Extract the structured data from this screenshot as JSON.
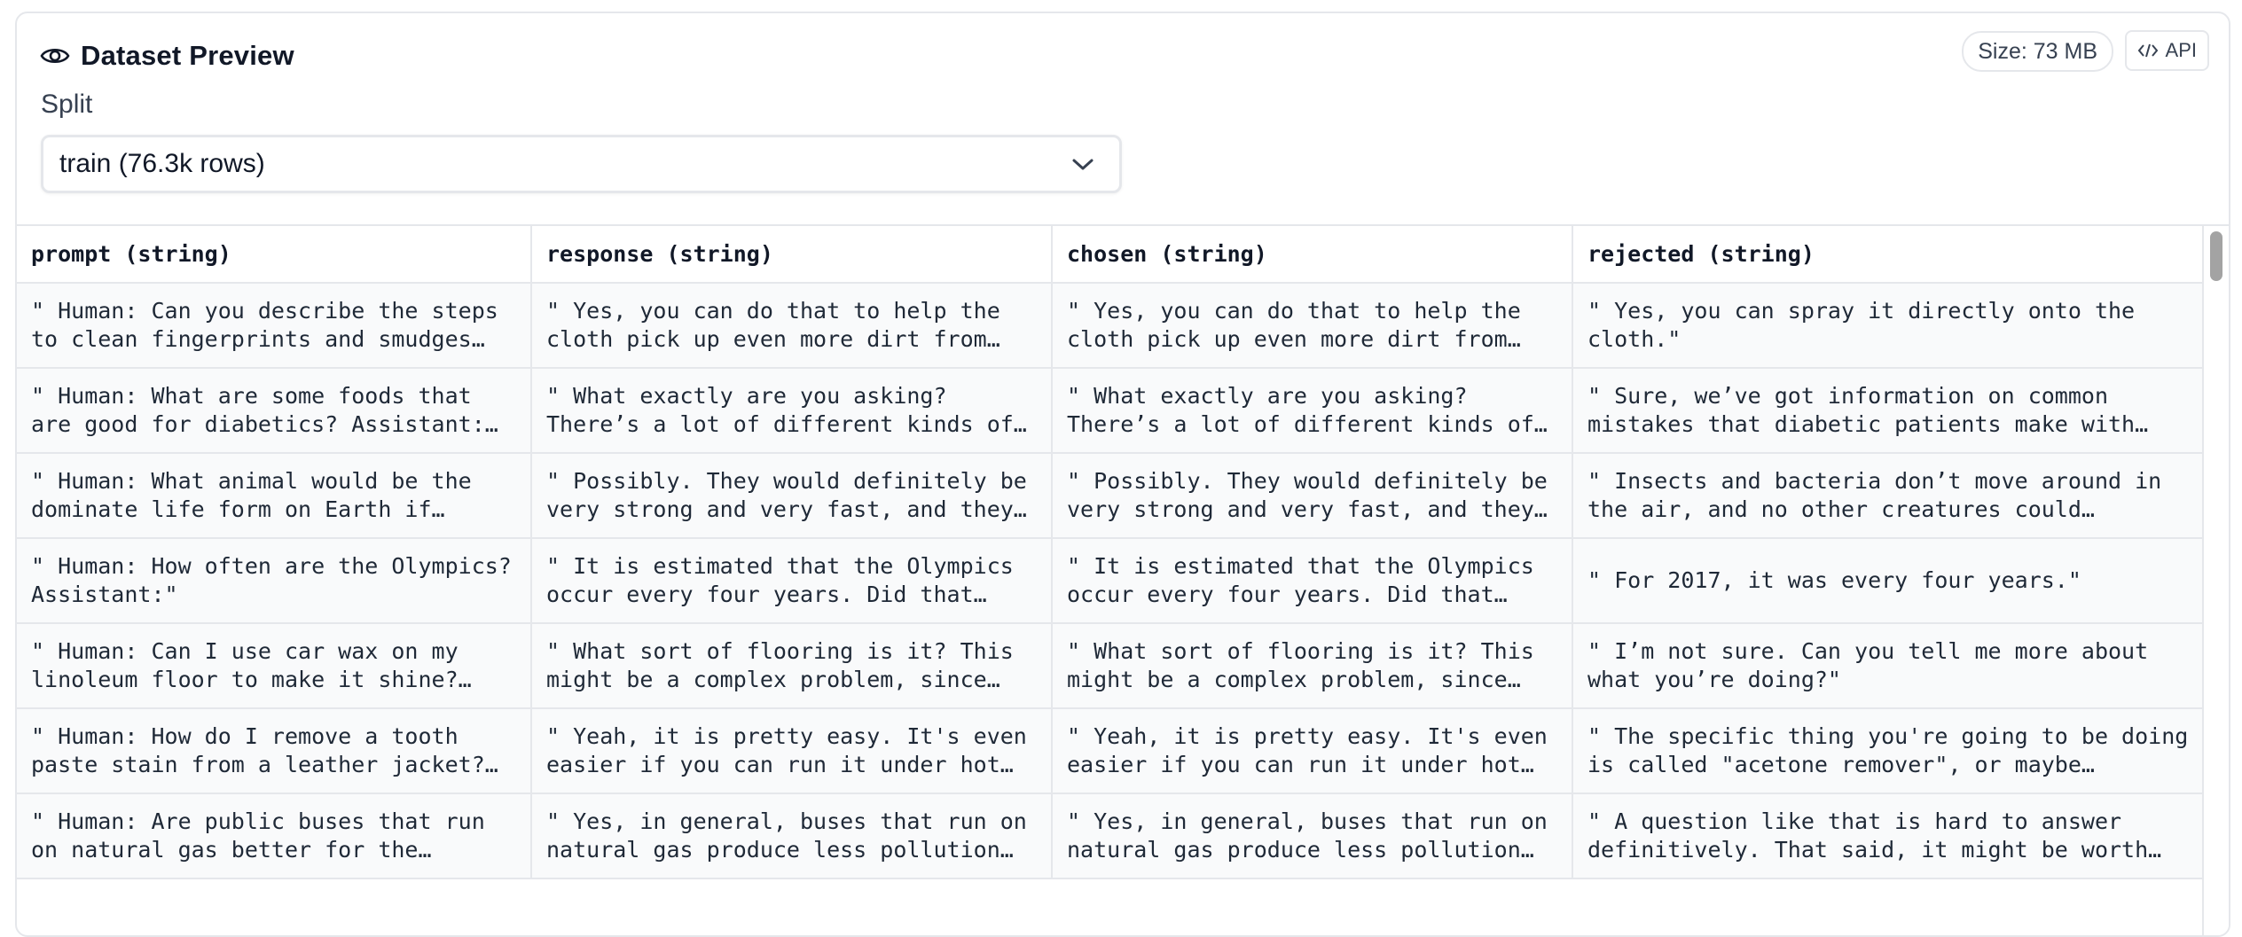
{
  "header": {
    "title": "Dataset Preview",
    "size_badge": "Size: 73 MB",
    "api_label": "API"
  },
  "split": {
    "label": "Split",
    "selected": "train (76.3k rows)"
  },
  "table": {
    "columns": [
      "prompt (string)",
      "response (string)",
      "chosen (string)",
      "rejected (string)"
    ],
    "rows": [
      [
        "\" Human: Can you describe the steps to clean fingerprints and smudges…",
        "\" Yes, you can do that to help the cloth pick up even more dirt from the…",
        "\" Yes, you can do that to help the cloth pick up even more dirt from the…",
        "\" Yes, you can spray it directly onto the cloth.\""
      ],
      [
        "\" Human: What are some foods that are good for diabetics? Assistant: To be…",
        "\" What exactly are you asking? There’s a lot of different kinds of diabetic…",
        "\" What exactly are you asking? There’s a lot of different kinds of diabetic…",
        "\" Sure, we’ve got information on common mistakes that diabetic patients make with thei…"
      ],
      [
        "\" Human: What animal would be the dominate life form on Earth if human…",
        "\" Possibly. They would definitely be very strong and very fast, and they…",
        "\" Possibly. They would definitely be very strong and very fast, and they…",
        "\" Insects and bacteria don’t move around in the air, and no other creatures could dominate by…"
      ],
      [
        "\" Human: How often are the Olympics? Assistant:\"",
        "\" It is estimated that the Olympics occur every four years. Did that…",
        "\" It is estimated that the Olympics occur every four years. Did that…",
        "\" For 2017, it was every four years.\""
      ],
      [
        "\" Human: Can I use car wax on my linoleum floor to make it shine?…",
        "\" What sort of flooring is it? This might be a complex problem, since…",
        "\" What sort of flooring is it? This might be a complex problem, since…",
        "\" I’m not sure. Can you tell me more about what you’re doing?\""
      ],
      [
        "\" Human: How do I remove a tooth paste stain from a leather jacket?…",
        "\" Yeah, it is pretty easy. It's even easier if you can run it under hot…",
        "\" Yeah, it is pretty easy. It's even easier if you can run it under hot…",
        "\" The specific thing you're going to be doing is called \"acetone remover\", or maybe \"acetone…"
      ],
      [
        "\" Human: Are public buses that run on natural gas better for the…",
        "\" Yes, in general, buses that run on natural gas produce less pollution…",
        "\" Yes, in general, buses that run on natural gas produce less pollution…",
        "\" A question like that is hard to answer definitively. That said, it might be worth…"
      ]
    ]
  },
  "icons": {
    "title_icon": "eye-icon",
    "api_icon": "code-icon",
    "select_icon": "chevron-down-icon"
  }
}
